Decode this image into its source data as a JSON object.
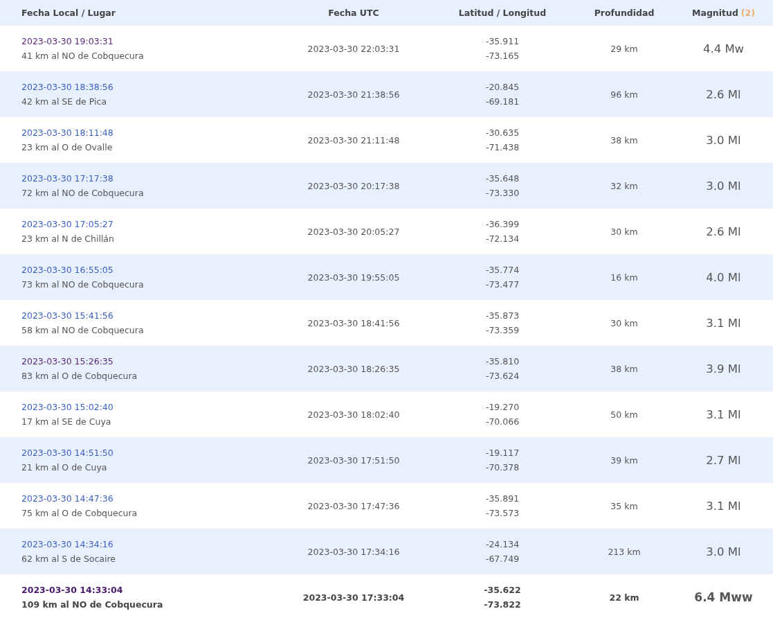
{
  "table": {
    "columns": [
      {
        "label": "Fecha Local / Lugar"
      },
      {
        "label": "Fecha UTC"
      },
      {
        "label": "Latitud / Longitud"
      },
      {
        "label": "Profundidad"
      },
      {
        "label": "Magnitud",
        "count": "(2)"
      }
    ],
    "rows": [
      {
        "local": "2023-03-30 19:03:31",
        "visited": true,
        "place": "41 km al NO de Cobquecura",
        "utc": "2023-03-30 22:03:31",
        "lat": "-35.911",
        "lon": "-73.165",
        "depth": "29 km",
        "magnitude": "4.4 Mw",
        "highlighted": false
      },
      {
        "local": "2023-03-30 18:38:56",
        "visited": false,
        "place": "42 km al SE de Pica",
        "utc": "2023-03-30 21:38:56",
        "lat": "-20.845",
        "lon": "-69.181",
        "depth": "96 km",
        "magnitude": "2.6 Ml",
        "highlighted": false
      },
      {
        "local": "2023-03-30 18:11:48",
        "visited": false,
        "place": "23 km al O de Ovalle",
        "utc": "2023-03-30 21:11:48",
        "lat": "-30.635",
        "lon": "-71.438",
        "depth": "38 km",
        "magnitude": "3.0 Ml",
        "highlighted": false
      },
      {
        "local": "2023-03-30 17:17:38",
        "visited": false,
        "place": "72 km al NO de Cobquecura",
        "utc": "2023-03-30 20:17:38",
        "lat": "-35.648",
        "lon": "-73.330",
        "depth": "32 km",
        "magnitude": "3.0 Ml",
        "highlighted": false
      },
      {
        "local": "2023-03-30 17:05:27",
        "visited": false,
        "place": "23 km al N de Chillán",
        "utc": "2023-03-30 20:05:27",
        "lat": "-36.399",
        "lon": "-72.134",
        "depth": "30 km",
        "magnitude": "2.6 Ml",
        "highlighted": false
      },
      {
        "local": "2023-03-30 16:55:05",
        "visited": false,
        "place": "73 km al NO de Cobquecura",
        "utc": "2023-03-30 19:55:05",
        "lat": "-35.774",
        "lon": "-73.477",
        "depth": "16 km",
        "magnitude": "4.0 Ml",
        "highlighted": false
      },
      {
        "local": "2023-03-30 15:41:56",
        "visited": false,
        "place": "58 km al NO de Cobquecura",
        "utc": "2023-03-30 18:41:56",
        "lat": "-35.873",
        "lon": "-73.359",
        "depth": "30 km",
        "magnitude": "3.1 Ml",
        "highlighted": false
      },
      {
        "local": "2023-03-30 15:26:35",
        "visited": true,
        "place": "83 km al O de Cobquecura",
        "utc": "2023-03-30 18:26:35",
        "lat": "-35.810",
        "lon": "-73.624",
        "depth": "38 km",
        "magnitude": "3.9 Ml",
        "highlighted": false
      },
      {
        "local": "2023-03-30 15:02:40",
        "visited": false,
        "place": "17 km al SE de Cuya",
        "utc": "2023-03-30 18:02:40",
        "lat": "-19.270",
        "lon": "-70.066",
        "depth": "50 km",
        "magnitude": "3.1 Ml",
        "highlighted": false
      },
      {
        "local": "2023-03-30 14:51:50",
        "visited": false,
        "place": "21 km al O de Cuya",
        "utc": "2023-03-30 17:51:50",
        "lat": "-19.117",
        "lon": "-70.378",
        "depth": "39 km",
        "magnitude": "2.7 Ml",
        "highlighted": false
      },
      {
        "local": "2023-03-30 14:47:36",
        "visited": false,
        "place": "75 km al O de Cobquecura",
        "utc": "2023-03-30 17:47:36",
        "lat": "-35.891",
        "lon": "-73.573",
        "depth": "35 km",
        "magnitude": "3.1 Ml",
        "highlighted": false
      },
      {
        "local": "2023-03-30 14:34:16",
        "visited": false,
        "place": "62 km al S de Socaire",
        "utc": "2023-03-30 17:34:16",
        "lat": "-24.134",
        "lon": "-67.749",
        "depth": "213 km",
        "magnitude": "3.0 Ml",
        "highlighted": false
      },
      {
        "local": "2023-03-30 14:33:04",
        "visited": true,
        "place": "109 km al NO de Cobquecura",
        "utc": "2023-03-30 17:33:04",
        "lat": "-35.622",
        "lon": "-73.822",
        "depth": "22 km",
        "magnitude": "6.4 Mww",
        "highlighted": true
      }
    ]
  }
}
